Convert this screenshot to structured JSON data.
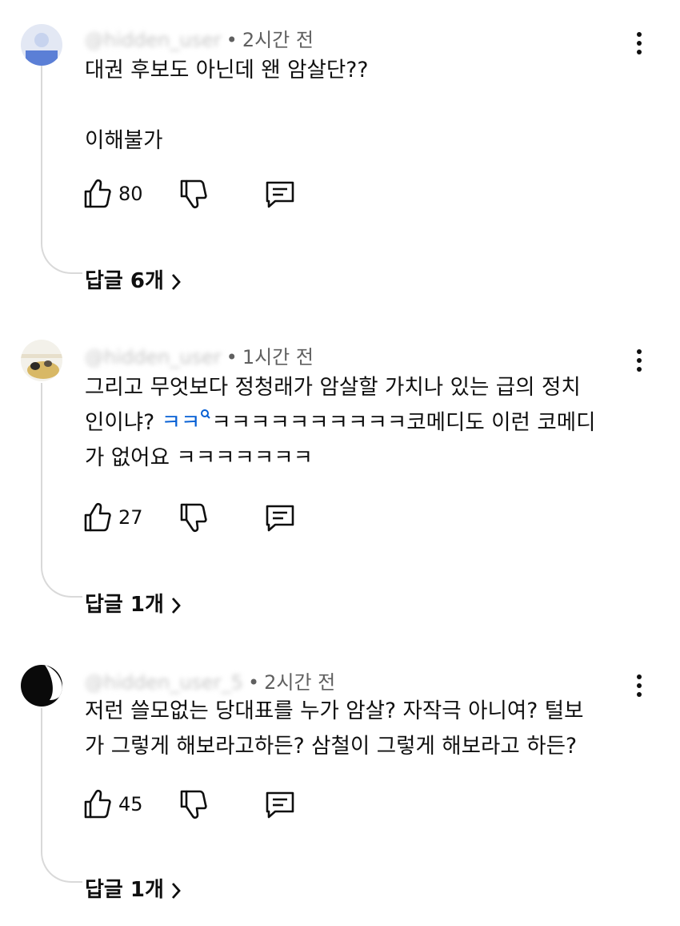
{
  "comments": [
    {
      "author": "@hidden_user",
      "time": "2시간 전",
      "lines": [
        "대권 후보도 아닌데 왠 암살단??",
        "",
        "이해불가"
      ],
      "likes": "80",
      "replies_label": "답글 6개"
    },
    {
      "author": "@hidden_user",
      "time": "1시간 전",
      "line1": "그리고 무엇보다 정청래가 암살할 가치나 있는 급의 정치",
      "line2_prefix": "인이냐? ",
      "line2_link": "ㅋㅋ",
      "line2_rest": "ㅋㅋㅋㅋㅋㅋㅋㅋㅋㅋ코메디도 이런 코메디",
      "line3": "가 없어요 ㅋㅋㅋㅋㅋㅋㅋ",
      "likes": "27",
      "replies_label": "답글 1개"
    },
    {
      "author": "@hidden_user_5",
      "time": "2시간 전",
      "lines": [
        "저런 쓸모없는 당대표를 누가 암살? 자작극 아니여? 털보",
        "가 그렇게 해보라고하든? 삼철이 그렇게  해보라고 하든?"
      ],
      "likes": "45",
      "replies_label": "답글 1개"
    }
  ],
  "icons": {
    "like": "thumbs-up-icon",
    "dislike": "thumbs-down-icon",
    "reply": "comment-icon",
    "more": "kebab-menu-icon",
    "expand": "chevron-right-icon",
    "search": "search-icon"
  },
  "colors": {
    "link": "#065fd4",
    "meta": "#606060",
    "thread": "#d9d9d9"
  }
}
